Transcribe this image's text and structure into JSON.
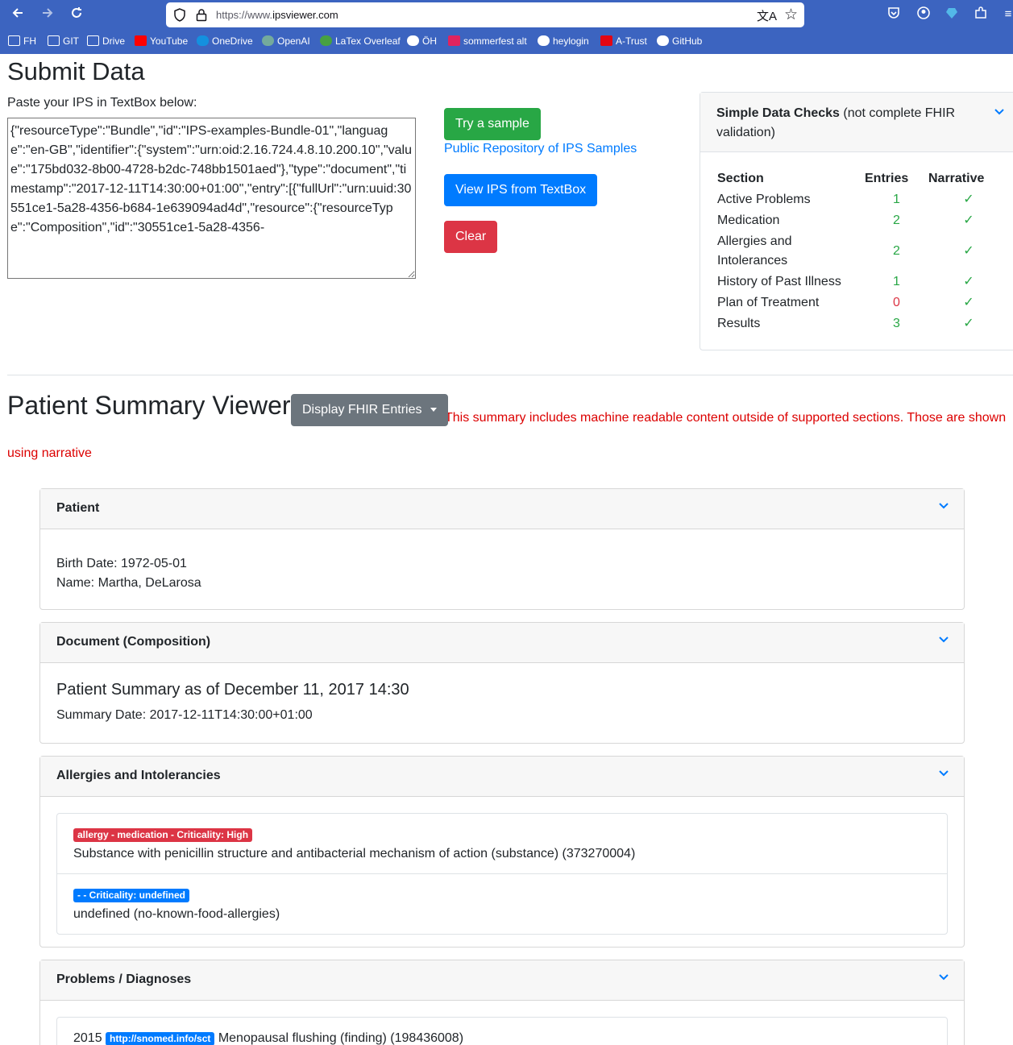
{
  "browser": {
    "url_scheme": "https://www.",
    "url_host": "ipsviewer.com",
    "bookmarks": [
      {
        "label": "FH",
        "icon": "folder-icon"
      },
      {
        "label": "GIT",
        "icon": "folder-icon"
      },
      {
        "label": "Drive",
        "icon": "folder-icon"
      },
      {
        "label": "YouTube",
        "icon": "youtube-icon"
      },
      {
        "label": "OneDrive",
        "icon": "onedrive-icon"
      },
      {
        "label": "OpenAI",
        "icon": "openai-icon"
      },
      {
        "label": "LaTex Overleaf",
        "icon": "overleaf-icon"
      },
      {
        "label": "ÖH",
        "icon": "oh-icon"
      },
      {
        "label": "sommerfest alt",
        "icon": "sommerfest-icon"
      },
      {
        "label": "heylogin",
        "icon": "heylogin-icon"
      },
      {
        "label": "A-Trust",
        "icon": "atrust-icon"
      },
      {
        "label": "GitHub",
        "icon": "github-icon"
      }
    ]
  },
  "submit": {
    "title": "Submit Data",
    "paste_label": "Paste your IPS in TextBox below:",
    "textbox_value": "{\"resourceType\":\"Bundle\",\"id\":\"IPS-examples-Bundle-01\",\"language\":\"en-GB\",\"identifier\":{\"system\":\"urn:oid:2.16.724.4.8.10.200.10\",\"value\":\"175bd032-8b00-4728-b2dc-748bb1501aed\"},\"type\":\"document\",\"timestamp\":\"2017-12-11T14:30:00+01:00\",\"entry\":[{\"fullUrl\":\"urn:uuid:30551ce1-5a28-4356-b684-1e639094ad4d\",\"resource\":{\"resourceType\":\"Composition\",\"id\":\"30551ce1-5a28-4356-",
    "try_sample": "Try a sample",
    "repo_link": "Public Repository of IPS Samples",
    "view_btn": "View IPS from TextBox",
    "clear_btn": "Clear"
  },
  "checks": {
    "title_bold": "Simple Data Checks",
    "title_rest": " (not complete FHIR validation)",
    "col_section": "Section",
    "col_entries": "Entries",
    "col_narrative": "Narrative",
    "rows": [
      {
        "section": "Active Problems",
        "entries": "1",
        "narrative": "✓"
      },
      {
        "section": "Medication",
        "entries": "2",
        "narrative": "✓"
      },
      {
        "section": "Allergies and Intolerances",
        "entries": "2",
        "narrative": "✓"
      },
      {
        "section": "History of Past Illness",
        "entries": "1",
        "narrative": "✓"
      },
      {
        "section": "Plan of Treatment",
        "entries": "0",
        "narrative": "✓"
      },
      {
        "section": "Results",
        "entries": "3",
        "narrative": "✓"
      }
    ]
  },
  "viewer": {
    "title": "Patient Summary Viewer",
    "display_btn": "Display FHIR Entries",
    "warning": "This summary includes machine readable content outside of supported sections. Those are shown using narrative"
  },
  "patient": {
    "header": "Patient",
    "birth_date": "Birth Date: 1972-05-01",
    "name": "Name: Martha, DeLarosa"
  },
  "document": {
    "header": "Document (Composition)",
    "title": "Patient Summary as of December 11, 2017 14:30",
    "date": "Summary Date: 2017-12-11T14:30:00+01:00"
  },
  "allergies": {
    "header": "Allergies and Intolerancies",
    "items": [
      {
        "badge": "allergy - medication - Criticality: High",
        "text": "Substance with penicillin structure and antibacterial mechanism of action (substance) (373270004)"
      },
      {
        "badge": "- - Criticality: undefined",
        "text": "undefined (no-known-food-allergies)"
      }
    ]
  },
  "problems": {
    "header": "Problems / Diagnoses",
    "items": [
      {
        "year": "2015",
        "badge": "http://snomed.info/sct",
        "text": "Menopausal flushing (finding) (198436008)"
      }
    ]
  },
  "colors": {
    "chrome": "#3c64c0",
    "primary": "#007bff",
    "success": "#28a745",
    "danger": "#dc3545",
    "secondary": "#6c757d",
    "warning_text": "#dc0000"
  }
}
